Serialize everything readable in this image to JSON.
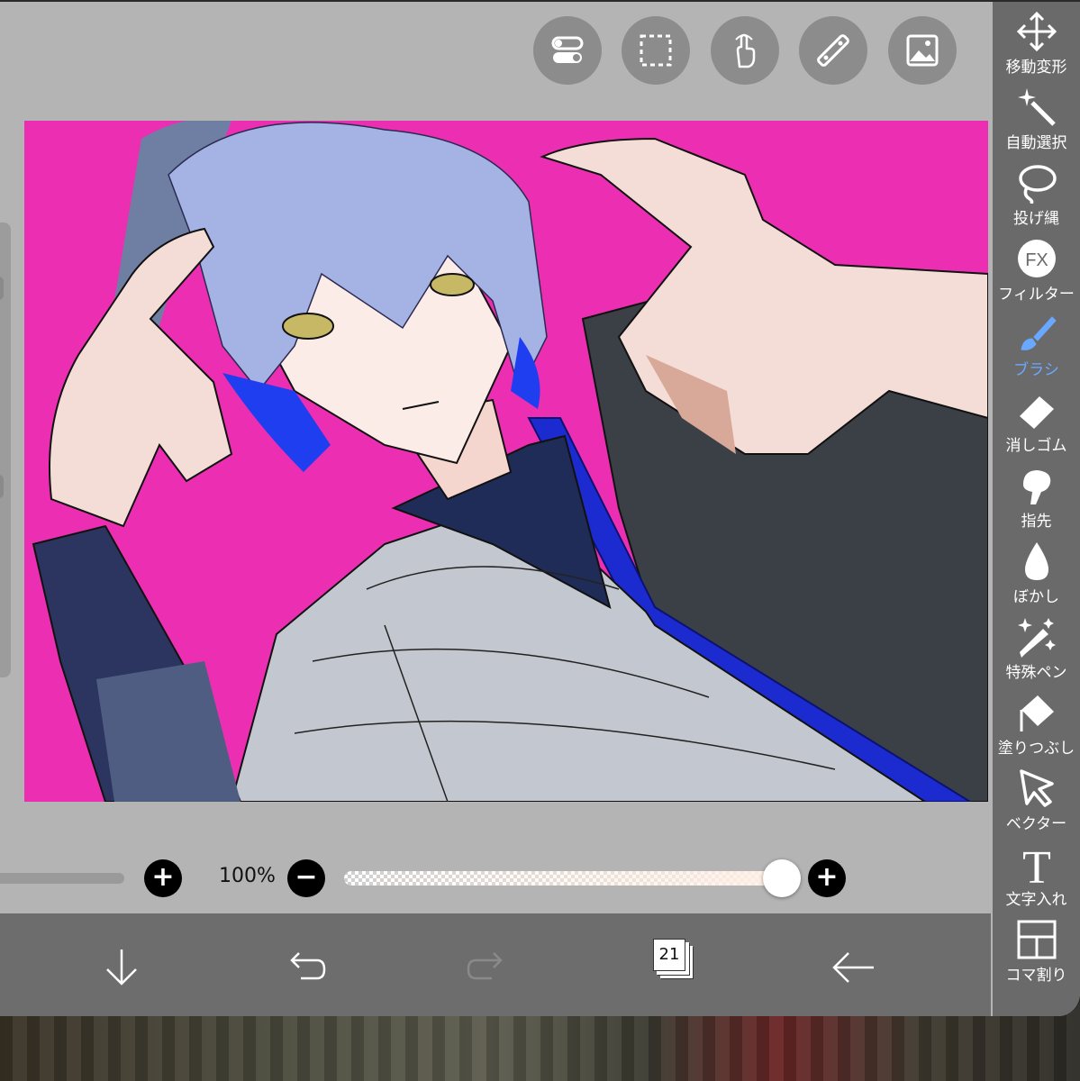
{
  "top_toolbar": {
    "icons": [
      "toggle-icon",
      "selection-icon",
      "hand-touch-icon",
      "ruler-icon",
      "image-icon"
    ]
  },
  "sidebar": {
    "tools": [
      {
        "label": "移動変形",
        "icon": "move-icon",
        "active": false
      },
      {
        "label": "自動選択",
        "icon": "magic-wand-icon",
        "active": false
      },
      {
        "label": "投げ縄",
        "icon": "lasso-icon",
        "active": false
      },
      {
        "label": "フィルター",
        "icon": "fx-icon",
        "active": false
      },
      {
        "label": "ブラシ",
        "icon": "brush-icon",
        "active": true
      },
      {
        "label": "消しゴム",
        "icon": "eraser-icon",
        "active": false
      },
      {
        "label": "指先",
        "icon": "finger-icon",
        "active": false
      },
      {
        "label": "ぼかし",
        "icon": "blur-drop-icon",
        "active": false
      },
      {
        "label": "特殊ペン",
        "icon": "special-pen-icon",
        "active": false
      },
      {
        "label": "塗りつぶし",
        "icon": "fill-bucket-icon",
        "active": false
      },
      {
        "label": "ベクター",
        "icon": "vector-cursor-icon",
        "active": false
      },
      {
        "label": "文字入れ",
        "icon": "text-t-icon",
        "active": false
      },
      {
        "label": "コマ割り",
        "icon": "frame-divider-icon",
        "active": false
      }
    ],
    "active_color": "#6aa8ff"
  },
  "brush_controls": {
    "opacity_label": "100%",
    "opacity_value": 1.0,
    "size_minus": "−",
    "size_plus": "+",
    "opacity_minus": "−",
    "opacity_plus": "+"
  },
  "bottom_bar": {
    "layer_count": "21",
    "icons": [
      "download-arrow-icon",
      "undo-icon",
      "redo-icon",
      "layers-icon",
      "back-arrow-icon"
    ]
  },
  "canvas": {
    "background_color": "#ec2fb2"
  }
}
